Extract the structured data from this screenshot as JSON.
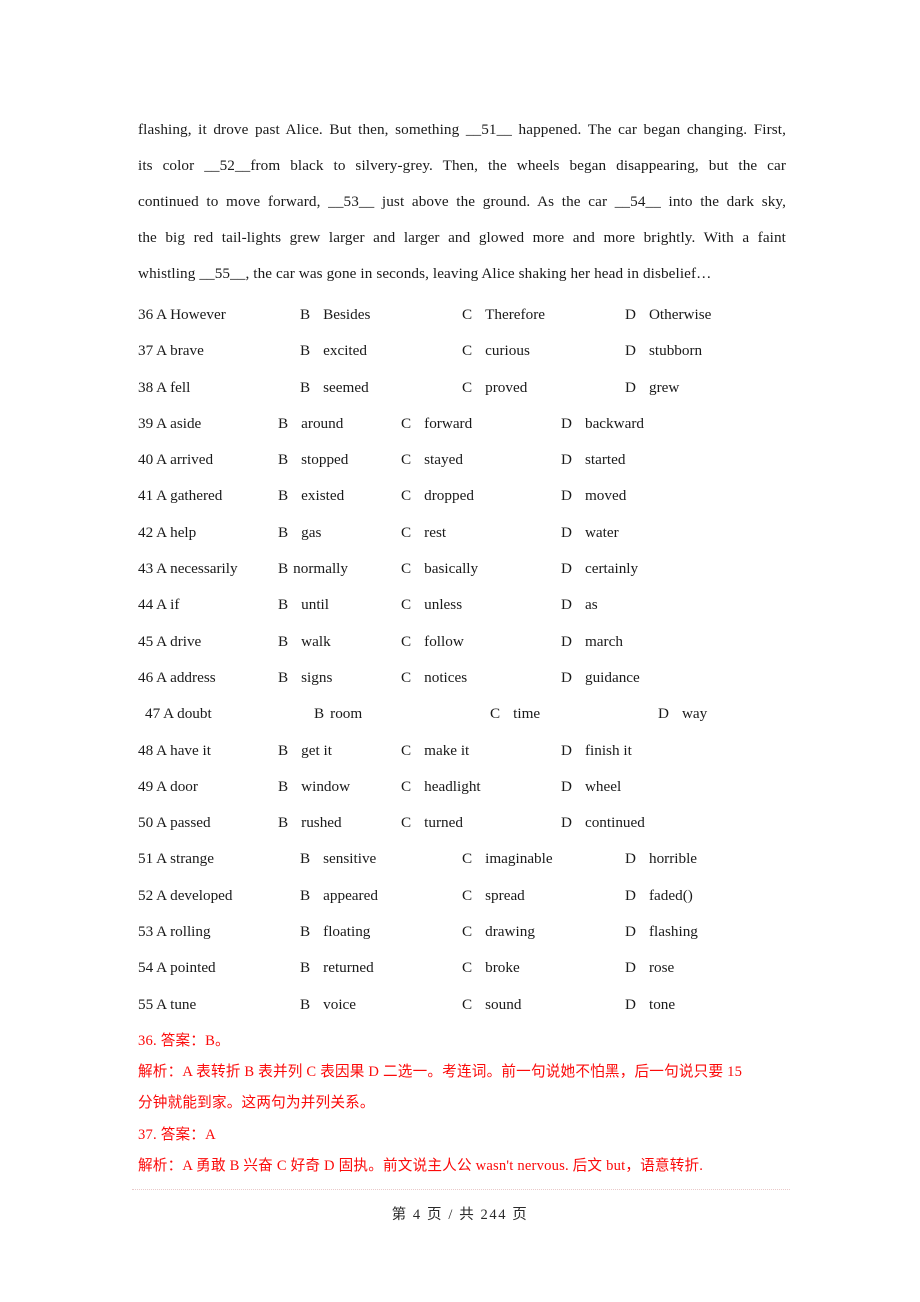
{
  "document": {
    "page_label_prefix": "第",
    "current_page": "4",
    "separator": "/",
    "total_prefix": "共",
    "total_pages": "244",
    "page_suffix": "页",
    "footer_text": "第 4 页 / 共 244 页",
    "accent_red": "#fb0a0a",
    "text_color": "#1a1a1a"
  },
  "passage": {
    "lines": [
      "flashing, it drove past Alice. But then, something __51__ happened. The car began changing. First,",
      "its color __52__from black to silvery-grey. Then, the wheels began disappearing, but the car",
      "continued to move forward, __53__ just above the ground. As the car __54__ into the dark sky,",
      "the big red tail-lights grew larger and larger and glowed more and more brightly. With a faint",
      "whistling __55__, the car was gone in seconds, leaving Alice shaking her head in disbelief…"
    ]
  },
  "questions": [
    {
      "number": "36",
      "layout": "wide",
      "a_label": "A",
      "a": "However",
      "b_label": "B",
      "b": "Besides",
      "c_label": "C",
      "c": "Therefore",
      "d_label": "D",
      "d": "Otherwise"
    },
    {
      "number": "37",
      "layout": "wide",
      "a_label": "A",
      "a": "brave",
      "b_label": "B",
      "b": "excited",
      "c_label": "C",
      "c": "curious",
      "d_label": "D",
      "d": "stubborn"
    },
    {
      "number": "38",
      "layout": "wide",
      "a_label": "A",
      "a": "fell",
      "b_label": "B",
      "b": "seemed",
      "c_label": "C",
      "c": "proved",
      "d_label": "D",
      "d": "grew"
    },
    {
      "number": "39",
      "layout": "narrow",
      "a_label": "A",
      "a": "aside",
      "b_label": "B",
      "b": "around",
      "c_label": "C",
      "c": "forward",
      "d_label": "D",
      "d": "backward"
    },
    {
      "number": "40",
      "layout": "narrow",
      "a_label": "A",
      "a": "arrived",
      "b_label": "B",
      "b": "stopped",
      "c_label": "C",
      "c": "stayed",
      "d_label": "D",
      "d": "started"
    },
    {
      "number": "41",
      "layout": "narrow",
      "a_label": "A",
      "a": "gathered",
      "b_label": "B",
      "b": "existed",
      "c_label": "C",
      "c": "dropped",
      "d_label": "D",
      "d": "moved"
    },
    {
      "number": "42",
      "layout": "narrow",
      "a_label": "A",
      "a": "help",
      "b_label": "B",
      "b": "gas",
      "c_label": "C",
      "c": "rest",
      "d_label": "D",
      "d": "water"
    },
    {
      "number": "43",
      "layout": "narrow",
      "a_label": "A",
      "a": "necessarily",
      "b_label": "B",
      "b": "normally",
      "c_label": "C",
      "c": "basically",
      "d_label": "D",
      "d": "certainly",
      "b_tight": true
    },
    {
      "number": "44",
      "layout": "narrow",
      "a_label": "A",
      "a": "if",
      "b_label": "B",
      "b": "until",
      "c_label": "C",
      "c": "unless",
      "d_label": "D",
      "d": "as"
    },
    {
      "number": "45",
      "layout": "narrow",
      "a_label": "A",
      "a": "drive",
      "b_label": "B",
      "b": "walk",
      "c_label": "C",
      "c": "follow",
      "d_label": "D",
      "d": "march"
    },
    {
      "number": "46",
      "layout": "narrow",
      "a_label": "A",
      "a": "address",
      "b_label": "B",
      "b": "signs",
      "c_label": "C",
      "c": "notices",
      "d_label": "D",
      "d": "guidance"
    },
    {
      "number": "47",
      "layout": "loose",
      "a_label": "A",
      "a": "doubt",
      "b_label": "B",
      "b": "room",
      "c_label": "C",
      "c": "time",
      "d_label": "D",
      "d": "way",
      "b_tight": true
    },
    {
      "number": "48",
      "layout": "narrow",
      "a_label": "A",
      "a": "have it",
      "b_label": "B",
      "b": "get it",
      "c_label": "C",
      "c": "make it",
      "d_label": "D",
      "d": "finish it"
    },
    {
      "number": "49",
      "layout": "narrow",
      "a_label": "A",
      "a": "door",
      "b_label": "B",
      "b": "window",
      "c_label": "C",
      "c": "headlight",
      "d_label": "D",
      "d": "wheel"
    },
    {
      "number": "50",
      "layout": "narrow",
      "a_label": "A",
      "a": "passed",
      "b_label": "B",
      "b": "rushed",
      "c_label": "C",
      "c": "turned",
      "d_label": "D",
      "d": "continued"
    },
    {
      "number": "51",
      "layout": "wide",
      "a_label": "A",
      "a": "strange",
      "b_label": "B",
      "b": "sensitive",
      "c_label": "C",
      "c": "imaginable",
      "d_label": "D",
      "d": "horrible"
    },
    {
      "number": "52",
      "layout": "wide",
      "a_label": "A",
      "a": "developed",
      "b_label": "B",
      "b": "appeared",
      "c_label": "C",
      "c": "spread",
      "d_label": "D",
      "d": "faded()"
    },
    {
      "number": "53",
      "layout": "wide",
      "a_label": "A",
      "a": "rolling",
      "b_label": "B",
      "b": "floating",
      "c_label": "C",
      "c": "drawing",
      "d_label": "D",
      "d": "flashing"
    },
    {
      "number": "54",
      "layout": "wide",
      "a_label": "A",
      "a": "pointed",
      "b_label": "B",
      "b": "returned",
      "c_label": "C",
      "c": "broke",
      "d_label": "D",
      "d": "rose"
    },
    {
      "number": "55",
      "layout": "wide",
      "a_label": "A",
      "a": "tune",
      "b_label": "B",
      "b": "voice",
      "c_label": "C",
      "c": "sound",
      "d_label": "D",
      "d": "tone"
    }
  ],
  "explanations": {
    "lines": [
      "36. 答案：B。",
      "解析：A 表转折 B 表并列 C 表因果 D 二选一。考连词。前一句说她不怕黑，后一句说只要 15",
      "分钟就能到家。这两句为并列关系。",
      "37. 答案：A",
      "解析：A 勇敢 B 兴奋 C 好奇 D 固执。前文说主人公 wasn't nervous. 后文 but，语意转折."
    ]
  }
}
